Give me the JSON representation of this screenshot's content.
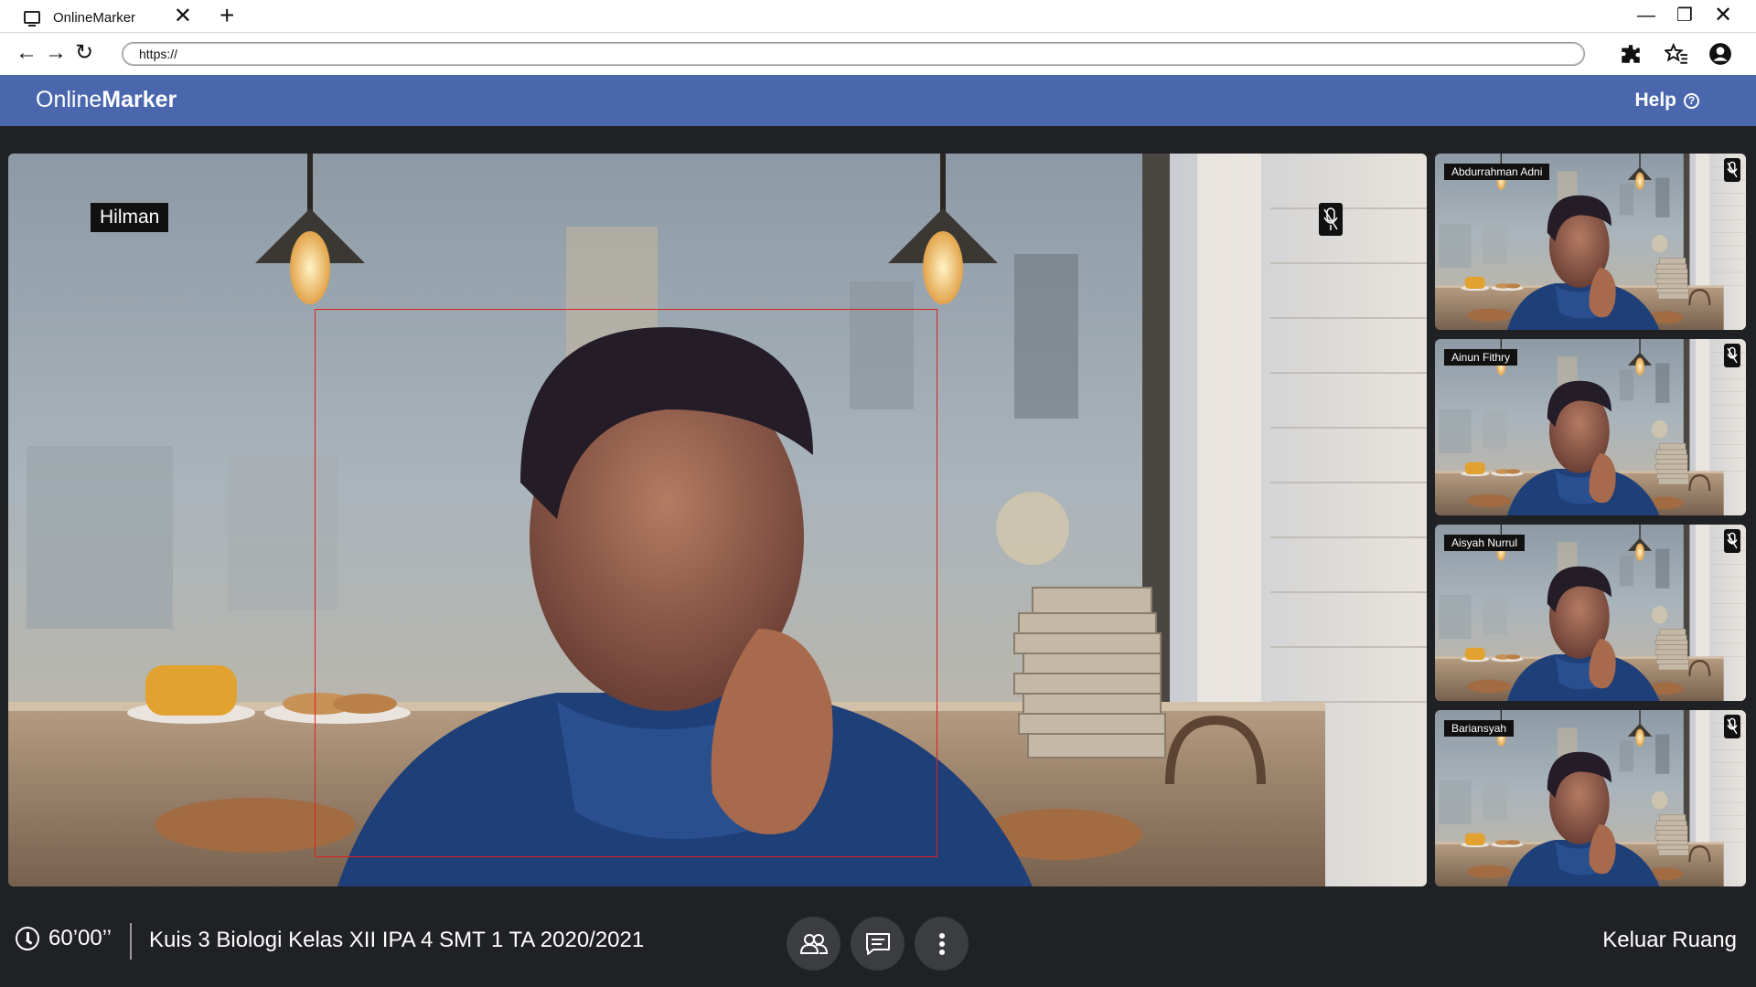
{
  "browser": {
    "tab_title": "OnlineMarker",
    "url": "https://"
  },
  "app": {
    "brand_light": "Online",
    "brand_bold": "Marker",
    "help_label": "Help",
    "accent_color": "#4a67ad"
  },
  "main_video": {
    "participant_name": "Hilman",
    "mic_muted": true,
    "face_box_color": "#e0201f"
  },
  "participants": [
    {
      "name": "Abdurrahman Adni",
      "mic_muted": true
    },
    {
      "name": "Ainun Fithry",
      "mic_muted": true
    },
    {
      "name": "Aisyah Nurrul",
      "mic_muted": true
    },
    {
      "name": "Bariansyah",
      "mic_muted": true
    }
  ],
  "bottom_bar": {
    "timer": "60’00’’",
    "quiz_title": "Kuis 3 Biologi Kelas XII IPA 4 SMT 1 TA 2020/2021",
    "controls": [
      "participants-icon",
      "chat-icon",
      "more-icon"
    ],
    "leave_label": "Keluar Ruang"
  }
}
